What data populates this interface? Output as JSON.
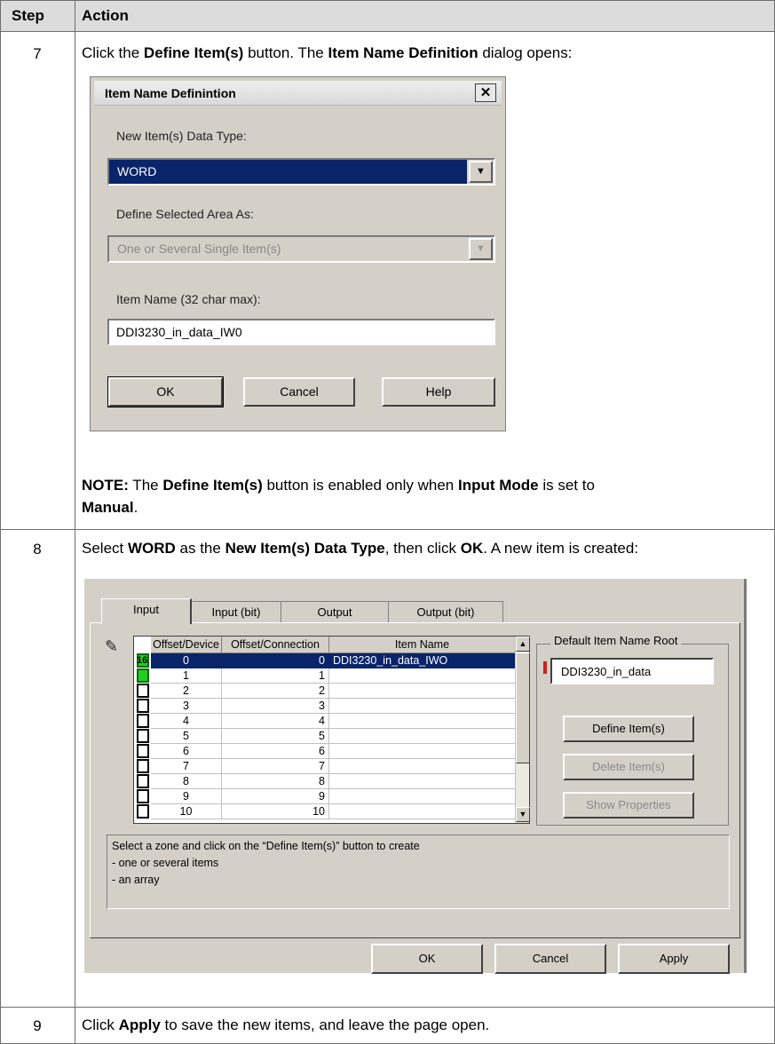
{
  "table": {
    "header_step": "Step",
    "header_action": "Action"
  },
  "step7": {
    "num": "7",
    "intro": {
      "pre": "Click the ",
      "b1": "Define Item(s)",
      "mid": " button. The ",
      "b2": "Item Name Definition",
      "post": " dialog opens:"
    },
    "dialog": {
      "title": "Item Name Definintion",
      "close": "✕",
      "data_type_label": "New Item(s) Data Type:",
      "data_type_value": "WORD",
      "area_label": "Define Selected Area As:",
      "area_value": "One or Several Single Item(s)",
      "name_label": "Item Name (32 char max):",
      "name_value": "DDI3230_in_data_IW0",
      "ok": "OK",
      "cancel": "Cancel",
      "help": "Help"
    },
    "note": {
      "label": "NOTE:",
      "pre": " The ",
      "b1": "Define Item(s)",
      "mid": " button is enabled only when ",
      "b2": "Input Mode",
      "post": " is set to",
      "b3": "Manual",
      "end": "."
    }
  },
  "step8": {
    "num": "8",
    "intro": {
      "pre": "Select ",
      "b1": "WORD",
      "mid1": " as the ",
      "b2": "New Item(s) Data Type",
      "mid2": ", then click ",
      "b3": "OK",
      "post": ". A new item is created:"
    },
    "dialog": {
      "tabs": [
        "Input",
        "Input (bit)",
        "Output",
        "Output (bit)"
      ],
      "columns": [
        "Offset/Device",
        "Offset/Connection",
        "Item Name"
      ],
      "rows": [
        {
          "device": "0",
          "connection": "0",
          "name": "DDI3230_in_data_IWO",
          "marker": "16"
        },
        {
          "device": "1",
          "connection": "1",
          "name": ""
        },
        {
          "device": "2",
          "connection": "2",
          "name": ""
        },
        {
          "device": "3",
          "connection": "3",
          "name": ""
        },
        {
          "device": "4",
          "connection": "4",
          "name": ""
        },
        {
          "device": "5",
          "connection": "5",
          "name": ""
        },
        {
          "device": "6",
          "connection": "6",
          "name": ""
        },
        {
          "device": "7",
          "connection": "7",
          "name": ""
        },
        {
          "device": "8",
          "connection": "8",
          "name": ""
        },
        {
          "device": "9",
          "connection": "9",
          "name": ""
        },
        {
          "device": "10",
          "connection": "10",
          "name": ""
        }
      ],
      "root_group_label": "Default Item Name Root",
      "root_value": "DDI3230_in_data",
      "define_btn": "Define Item(s)",
      "delete_btn": "Delete Item(s)",
      "props_btn": "Show Properties",
      "hint_lines": [
        "Select a zone and click on the “Define Item(s)” button to create",
        "- one or several items",
        "- an array"
      ],
      "ok": "OK",
      "cancel": "Cancel",
      "apply": "Apply"
    }
  },
  "step9": {
    "num": "9",
    "pre": "Click ",
    "b1": "Apply",
    "post": " to save the new items, and leave the page open."
  },
  "colors": {
    "header_bg": "#dcdcdc",
    "dialog_bg": "#d4d0c8",
    "selection": "#0a246a",
    "marker_green": "#22cc22"
  }
}
